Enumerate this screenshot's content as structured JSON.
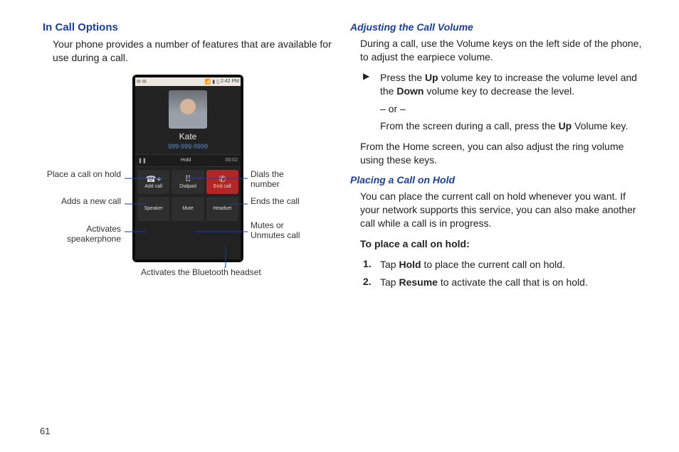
{
  "left": {
    "heading": "In Call Options",
    "intro": "Your phone provides a number of features that are available for use during a call.",
    "callouts": {
      "hold": "Place a call on hold",
      "addcall": "Adds a new call",
      "speaker": "Activates speakerphone",
      "dials": "Dials the number",
      "endcall": "Ends the call",
      "mute": "Mutes or Unmutes call",
      "headset": "Activates the Bluetooth headset"
    },
    "phone": {
      "time": "2:42 PM",
      "name": "Kate",
      "number": "999-999-9999",
      "holdbar_mid": "Hold",
      "holdbar_right": "00:02",
      "btn_addcall": "Add call",
      "btn_dialpad": "Dialpad",
      "btn_endcall": "End call",
      "btn_speaker": "Speaker",
      "btn_mute": "Mute",
      "btn_headset": "Headset"
    }
  },
  "right": {
    "adjvol": {
      "heading": "Adjusting the Call Volume",
      "p1": "During a call, use the Volume keys on the left side of the phone, to adjust the earpiece volume.",
      "bullet_a": "Press the ",
      "bullet_up": "Up",
      "bullet_b": " volume key to increase the volume level and the ",
      "bullet_down": "Down",
      "bullet_c": " volume key to decrease the level.",
      "or": "– or –",
      "bullet_d": "From the screen during a call, press the ",
      "bullet_up2": "Up",
      "bullet_e": " Volume key.",
      "p2": "From the Home screen, you can also adjust the ring volume using these keys."
    },
    "hold": {
      "heading": "Placing a Call on Hold",
      "p1": "You can place the current call on hold whenever you want. If your network supports this service, you can also make another call while a call is in progress.",
      "lead": "To place a call on hold:",
      "step1_a": "Tap ",
      "step1_hold": "Hold",
      "step1_b": " to place the current call on hold.",
      "step2_a": "Tap ",
      "step2_resume": "Resume",
      "step2_b": " to activate the call that is on hold."
    }
  },
  "pagenum": "61"
}
